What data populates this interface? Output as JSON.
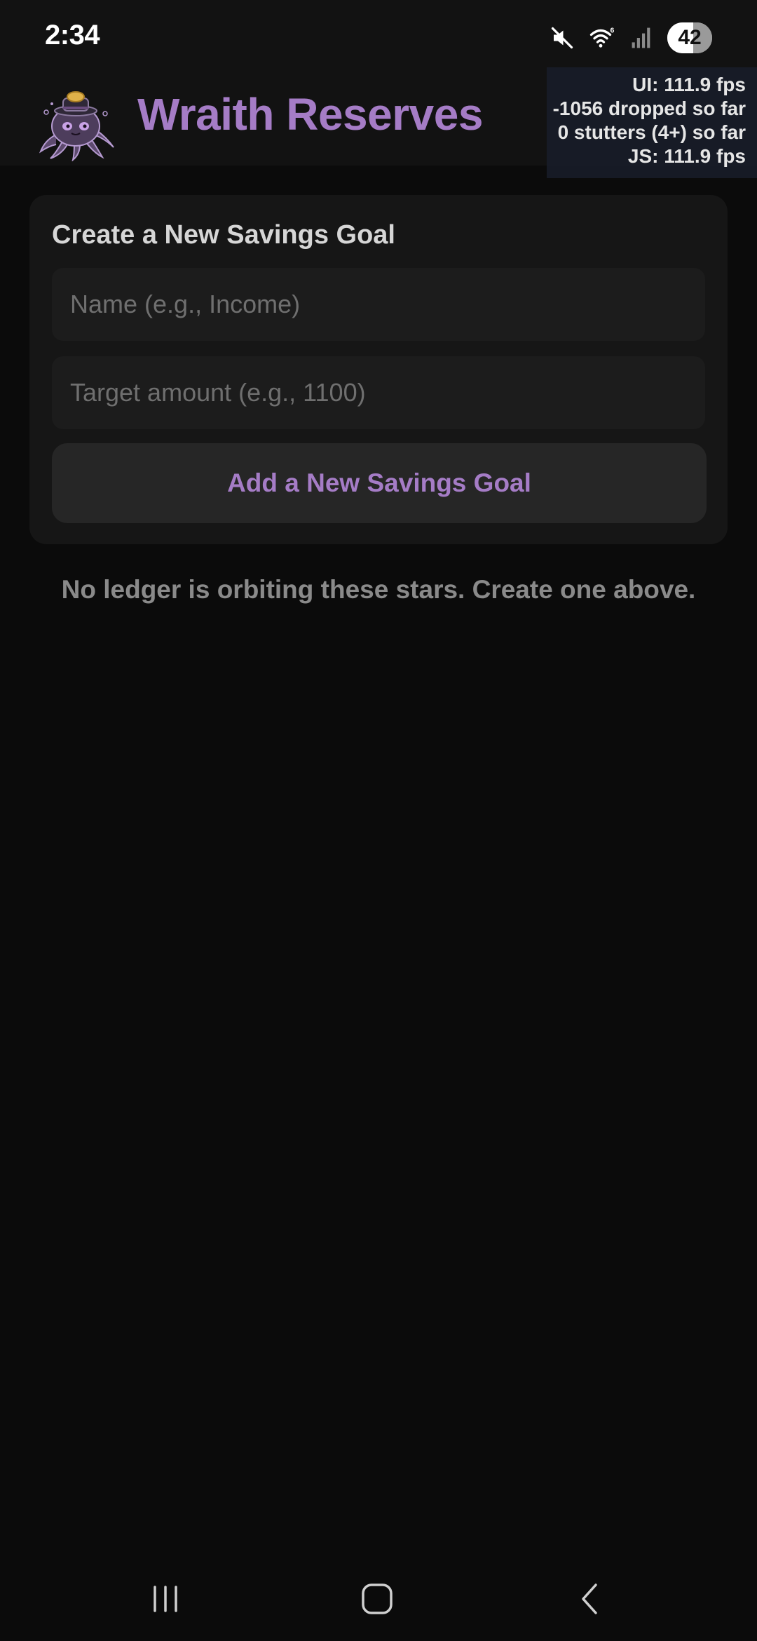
{
  "status_bar": {
    "time": "2:34",
    "battery_level": "42",
    "icons": [
      "mute-icon",
      "wifi-icon",
      "signal-icon",
      "battery-icon"
    ]
  },
  "header": {
    "app_title": "Wraith Reserves",
    "logo_icon": "octopus-mascot-icon",
    "title_color": "#a57cc6"
  },
  "perf_overlay": {
    "ui_fps": "UI: 111.9 fps",
    "dropped": "-1056 dropped so far",
    "stutters": "0 stutters (4+) so far",
    "js_fps": "JS: 111.9 fps"
  },
  "goal_form": {
    "title": "Create a New Savings Goal",
    "name_placeholder": "Name (e.g., Income)",
    "target_placeholder": "Target amount (e.g., 1100)",
    "add_button_label": "Add a New Savings Goal"
  },
  "empty_state": {
    "message": "No ledger is orbiting these stars. Create one above."
  },
  "nav_bar": {
    "icons": [
      "recents-icon",
      "home-icon",
      "back-icon"
    ]
  }
}
